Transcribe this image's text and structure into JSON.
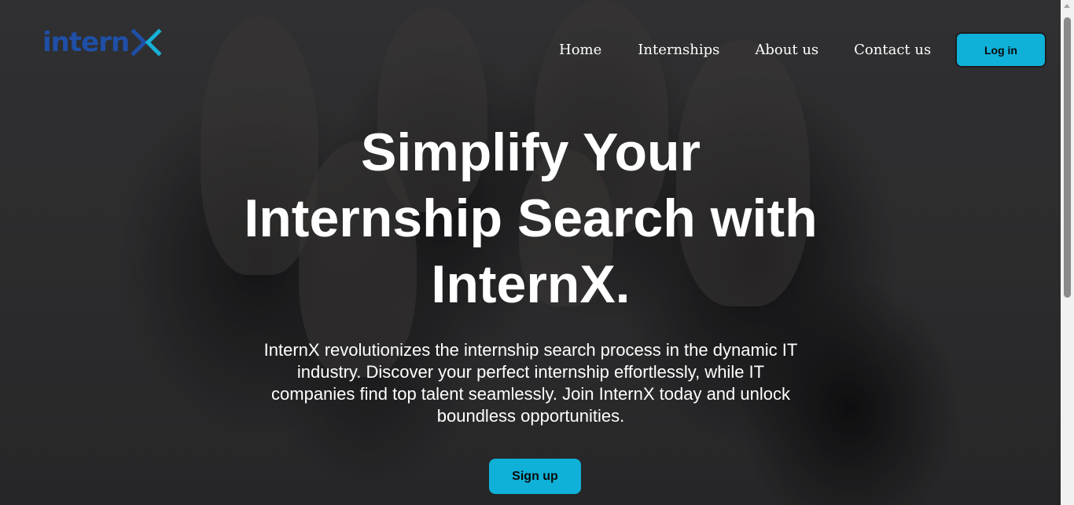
{
  "brand": {
    "logo_text": "intern",
    "logo_mark": "X",
    "logo_color": "#1f4fa6",
    "mark_colors": [
      "#1f4fa6",
      "#16b0d6"
    ]
  },
  "nav": {
    "items": [
      {
        "label": "Home"
      },
      {
        "label": "Internships"
      },
      {
        "label": "About us"
      },
      {
        "label": "Contact us"
      }
    ]
  },
  "header": {
    "login_label": "Log in"
  },
  "hero": {
    "title": "Simplify Your Internship Search with InternX.",
    "description": "InternX revolutionizes the internship search process in the dynamic IT industry. Discover your perfect internship effortlessly, while IT companies find top talent seamlessly. Join InternX today and unlock boundless opportunities.",
    "signup_label": "Sign up"
  },
  "colors": {
    "accent": "#0fb1d8",
    "text": "#ffffff",
    "background": "#3a3a3c"
  }
}
